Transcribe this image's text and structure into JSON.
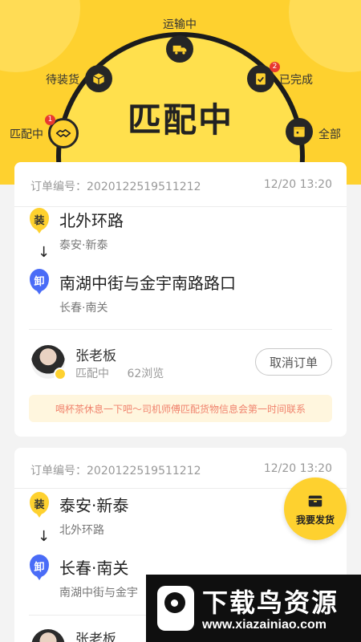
{
  "status_title": "匹配中",
  "status_nodes": [
    {
      "label": "匹配中",
      "icon": "handshake-icon",
      "badge": "1"
    },
    {
      "label": "待装货",
      "icon": "box-icon",
      "badge": ""
    },
    {
      "label": "运输中",
      "icon": "truck-icon",
      "badge": ""
    },
    {
      "label": "已完成",
      "icon": "clipboard-check-icon",
      "badge": "2"
    },
    {
      "label": "全部",
      "icon": "calendar-icon",
      "badge": ""
    }
  ],
  "orders": [
    {
      "order_no_label": "订单编号：2020122519511212",
      "time": "12/20 13:20",
      "load_tag": "装",
      "load_place": "北外环路",
      "load_sub": "泰安·新泰",
      "arrow": "↓",
      "unload_tag": "卸",
      "unload_place": "南湖中街与金宇南路路口",
      "unload_sub": "长春·南关",
      "boss_name": "张老板",
      "boss_status": "匹配中",
      "views": "62浏览",
      "cancel_label": "取消订单",
      "notice": "喝杯茶休息一下吧～司机师傅匹配货物信息会第一时间联系"
    },
    {
      "order_no_label": "订单编号：2020122519511212",
      "time": "12/20 13:20",
      "load_tag": "装",
      "load_place": "泰安·新泰",
      "load_sub": "北外环路",
      "arrow": "↓",
      "unload_tag": "卸",
      "unload_place": "长春·南关",
      "unload_sub": "南湖中街与金宇",
      "boss_name": "张老板"
    }
  ],
  "fab_label": "我要发货",
  "watermark": {
    "title": "下载鸟资源",
    "url": "www.xiazainiao.com"
  },
  "colors": {
    "brand_yellow": "#fed12f",
    "badge_red": "#e8382f",
    "unload_blue": "#4a6cf7",
    "notice_text": "#f0836d"
  }
}
